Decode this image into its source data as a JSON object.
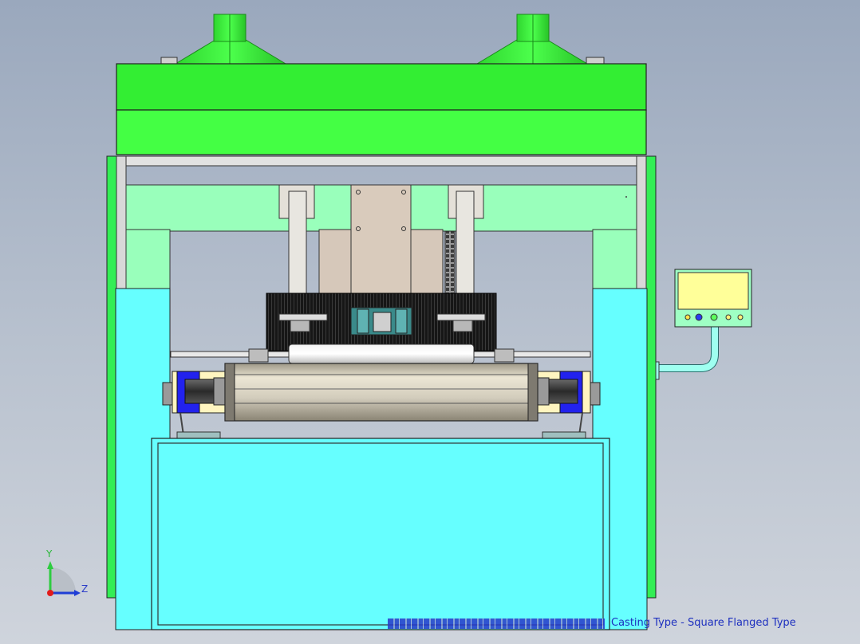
{
  "viewport": {
    "background_top": "#9aa8bd",
    "background_bottom": "#cfd4dc"
  },
  "model": {
    "status_text": "Casting Type - Square Flanged Type",
    "colors": {
      "hopper": "#33ee33",
      "hopper_edge": "#1a8a1a",
      "top_box": "#33ee33",
      "frame_light_green": "#99ffbb",
      "frame_cyan": "#66ffff",
      "column_grey": "#d8d4cc",
      "carriage_tan": "#d6c8ba",
      "brush_black": "#141414",
      "bearing_blue": "#2222ee",
      "bearing_cream": "#fff5c0",
      "drum_grey": "#c8c2b4",
      "panel_body": "#9fffc4",
      "panel_screen": "#ffff99",
      "pipe_green": "#9ffff0",
      "outline": "#222222"
    }
  },
  "triad": {
    "y_label": "Y",
    "z_label": "Z",
    "colors": {
      "y": "#2ecc40",
      "z": "#1f3ed6",
      "x": "#e21b1b"
    }
  }
}
